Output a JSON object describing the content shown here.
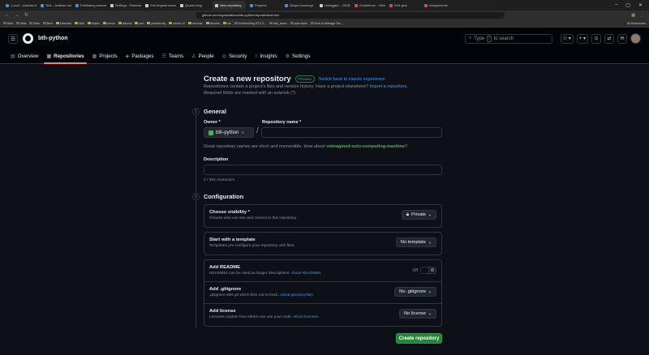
{
  "browser": {
    "tabs": [
      {
        "label": "1 post – Arabian Ant",
        "color": "#4a90d9",
        "active": false
      },
      {
        "label": "Test – Arabian Ant",
        "color": "#4a90d9",
        "active": false
      },
      {
        "label": "Publishing exercise",
        "color": "#4a90d9",
        "active": false
      },
      {
        "label": "Settings · Roberts",
        "color": "#cccccc",
        "active": false
      },
      {
        "label": "Pull request search",
        "color": "#cccccc",
        "active": false
      },
      {
        "label": "Quarto blog",
        "color": "#cccccc",
        "active": false
      },
      {
        "label": "New repository",
        "color": "#cccccc",
        "active": true
      },
      {
        "label": "Projects",
        "color": "#4a90d9",
        "active": false
      },
      {
        "label": "Skapa konverga",
        "color": "#4a90d9",
        "active": false
      },
      {
        "label": "Untagged – GEAR",
        "color": "#cccccc",
        "active": false
      },
      {
        "label": "Gradebook – Web",
        "color": "#d94a4a",
        "active": false
      },
      {
        "label": "Sort girls",
        "color": "#d94a4a",
        "active": false
      },
      {
        "label": "Assignments",
        "color": "#d94a4a",
        "active": false
      }
    ],
    "url": "github.com/organizations/bth-python/repositories/new",
    "bookmarks": [
      {
        "label": "Best",
        "folder": false
      },
      {
        "label": "Best",
        "folder": false
      },
      {
        "label": "Best",
        "folder": false
      },
      {
        "label": "Best",
        "folder": false
      },
      {
        "label": "Kalender",
        "folder": true
      },
      {
        "label": "Mail",
        "folder": true
      },
      {
        "label": "bokisx",
        "folder": true
      },
      {
        "label": "server",
        "folder": true
      },
      {
        "label": "alkohol",
        "folder": true
      },
      {
        "label": "ped",
        "folder": true
      },
      {
        "label": "publiksurify",
        "folder": true
      },
      {
        "label": "server v2",
        "folder": true
      },
      {
        "label": "torrente",
        "folder": true
      },
      {
        "label": "devolde",
        "folder": true
      },
      {
        "label": "ink",
        "folder": true
      },
      {
        "label": "Underwriting RTX 3...",
        "folder": false
      },
      {
        "label": "raw_score",
        "folder": false
      },
      {
        "label": "open links",
        "folder": false
      },
      {
        "label": "How to Manage Tas...",
        "folder": false
      }
    ],
    "all_bookmarks": "All Bookmarks"
  },
  "header": {
    "org_name": "bth-python",
    "search_label": "Type",
    "search_key": "/",
    "search_suffix": "to search",
    "plus": "+"
  },
  "nav": {
    "items": [
      {
        "label": "Overview",
        "icon": "▤",
        "active": false
      },
      {
        "label": "Repositories",
        "icon": "▣",
        "active": true
      },
      {
        "label": "Projects",
        "icon": "▦",
        "active": false
      },
      {
        "label": "Packages",
        "icon": "◈",
        "active": false
      },
      {
        "label": "Teams",
        "icon": "☷",
        "active": false
      },
      {
        "label": "People",
        "icon": "♙",
        "active": false
      },
      {
        "label": "Security",
        "icon": "◎",
        "active": false
      },
      {
        "label": "Insights",
        "icon": "⌇",
        "active": false
      },
      {
        "label": "Settings",
        "icon": "⚙",
        "active": false
      }
    ]
  },
  "page": {
    "title": "Create a new repository",
    "preview_badge": "Preview",
    "classic_link": "Switch back to classic experience",
    "subtitle_text": "Repositories contain a project's files and version history. Have a project elsewhere?",
    "import_link": "Import a repository.",
    "required_note": "Required fields are marked with an asterisk (*)."
  },
  "general": {
    "num": "1",
    "title": "General",
    "owner_label": "Owner *",
    "owner_value": "bth-python",
    "slash": "/",
    "repo_label": "Repository name *",
    "hint_text": "Great repository names are short and memorable. How about",
    "hint_suggestion": "reimagined-octo-computing-machine",
    "hint_end": "?",
    "description_label": "Description",
    "counter": "0 / 350 characters"
  },
  "configuration": {
    "num": "2",
    "title": "Configuration",
    "visibility": {
      "title": "Choose visibility *",
      "desc": "Choose who can see and commit to this repository",
      "value": "Private"
    },
    "template": {
      "title": "Start with a template",
      "desc": "Templates pre-configure your repository with files.",
      "value": "No template"
    },
    "readme": {
      "title": "Add README",
      "desc": "READMEs can be used as longer descriptions.",
      "link": "About READMEs",
      "toggle_label": "Off"
    },
    "gitignore": {
      "title": "Add .gitignore",
      "desc": ".gitignore tells git which files not to track.",
      "link": "About ignoring files",
      "value": "No .gitignore"
    },
    "license": {
      "title": "Add license",
      "desc": "Licenses explain how others can use your code.",
      "link": "About licenses",
      "value": "No license"
    }
  },
  "create_button": "Create repository"
}
